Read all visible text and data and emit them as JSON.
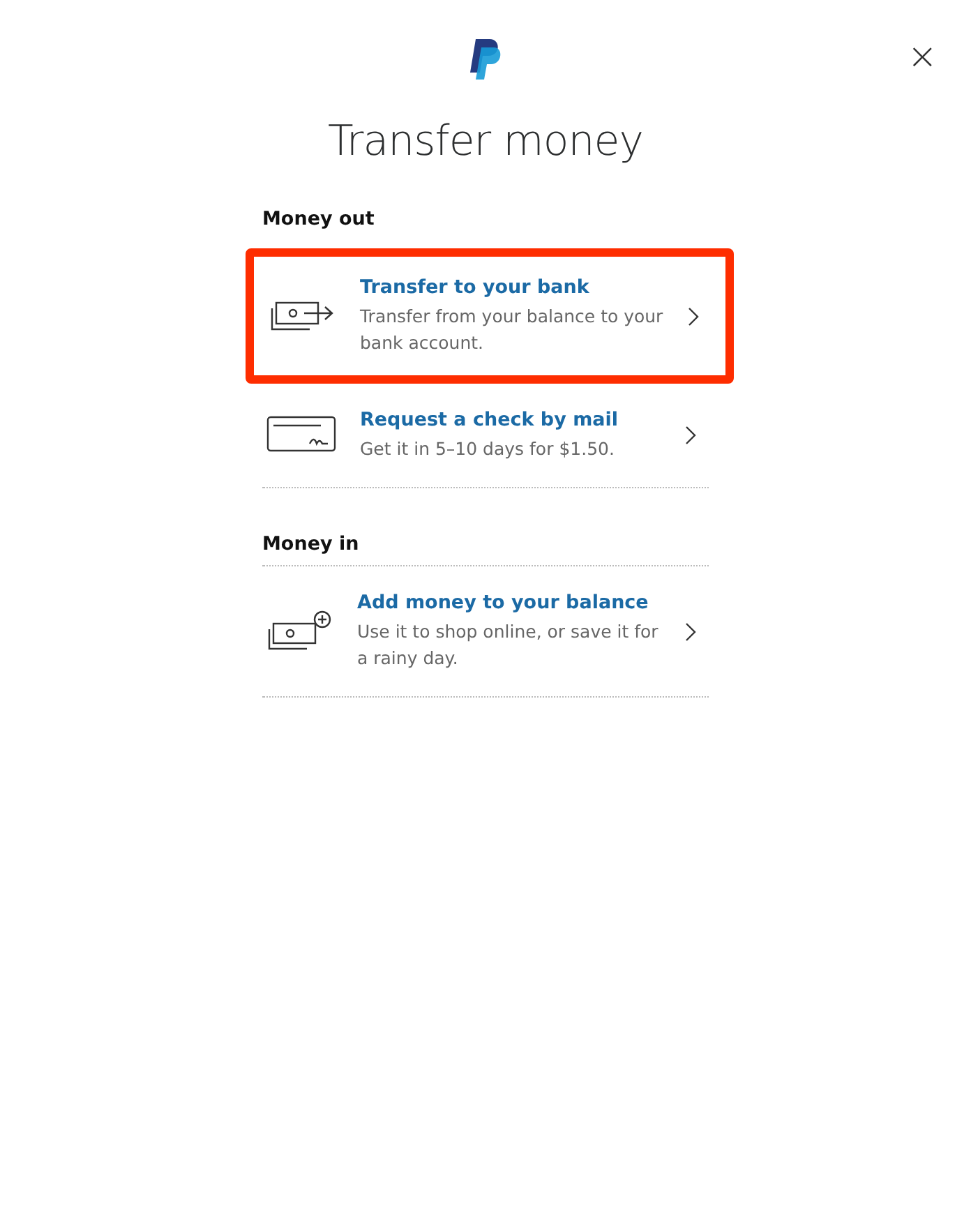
{
  "header": {
    "close": "×"
  },
  "title": "Transfer money",
  "sections": [
    {
      "heading": "Money out",
      "items": [
        {
          "kind": "bank",
          "title": "Transfer to your bank",
          "description": "Transfer from your balance to your bank account.",
          "highlighted": true
        },
        {
          "kind": "check",
          "title": "Request a check by mail",
          "description": "Get it in 5–10 days for $1.50.",
          "highlighted": false
        }
      ]
    },
    {
      "heading": "Money in",
      "items": [
        {
          "kind": "add",
          "title": "Add money to your balance",
          "description": "Use it to shop online, or save it for a rainy day.",
          "highlighted": false
        }
      ]
    }
  ]
}
